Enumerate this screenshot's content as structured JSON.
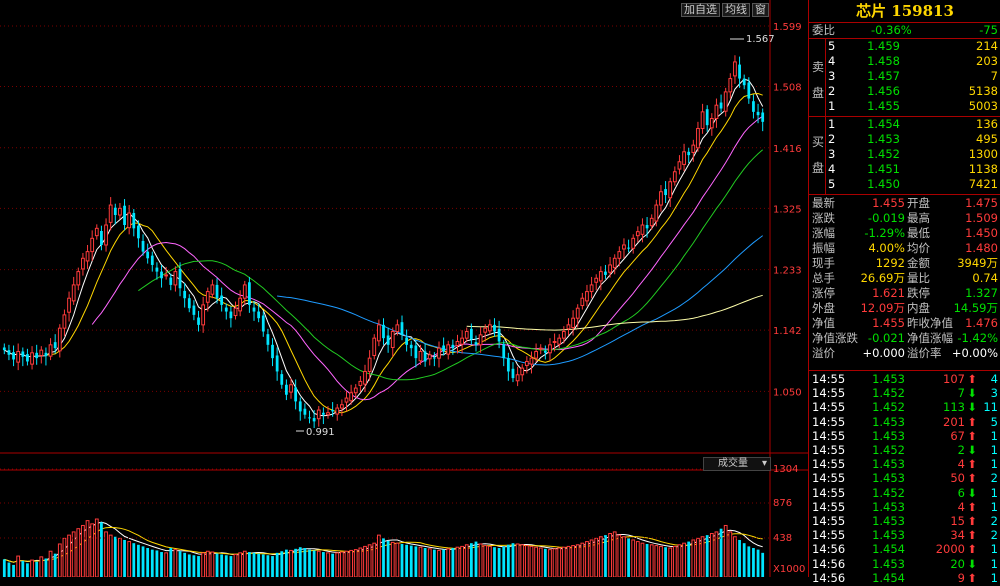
{
  "toolbar": {
    "btn1": "加自选",
    "btn2": "均线",
    "btn3": "窗"
  },
  "price_axis": {
    "labels": [
      "1.599",
      "1.508",
      "1.416",
      "1.325",
      "1.233",
      "1.142",
      "1.050"
    ],
    "min": 0.965,
    "max": 1.62
  },
  "annotations": {
    "high": "1.567",
    "low": "0.991"
  },
  "volume_axis": {
    "labels": [
      "1304",
      "876",
      "438",
      "X1000"
    ],
    "menu": "成交量"
  },
  "colors": {
    "up": "#ff3b3b",
    "down": "#00e5ff",
    "ma5": "#ffffff",
    "ma10": "#ffd700",
    "ma20": "#ff66ff",
    "ma30": "#22cc22",
    "ma60": "#1e9bff",
    "ma120": "#ffffaa"
  },
  "chart_data": {
    "type": "candlestick",
    "closes": [
      1.112,
      1.105,
      1.098,
      1.11,
      1.102,
      1.095,
      1.108,
      1.1,
      1.112,
      1.103,
      1.12,
      1.115,
      1.145,
      1.165,
      1.19,
      1.21,
      1.23,
      1.25,
      1.26,
      1.28,
      1.295,
      1.27,
      1.3,
      1.33,
      1.315,
      1.325,
      1.3,
      1.318,
      1.295,
      1.28,
      1.26,
      1.25,
      1.24,
      1.23,
      1.22,
      1.225,
      1.21,
      1.23,
      1.205,
      1.19,
      1.175,
      1.165,
      1.15,
      1.18,
      1.2,
      1.21,
      1.19,
      1.18,
      1.17,
      1.16,
      1.175,
      1.19,
      1.21,
      1.18,
      1.17,
      1.16,
      1.14,
      1.12,
      1.1,
      1.08,
      1.06,
      1.045,
      1.06,
      1.035,
      1.02,
      1.015,
      1.01,
      1.005,
      1.022,
      1.015,
      1.018,
      1.02,
      1.025,
      1.03,
      1.04,
      1.048,
      1.055,
      1.065,
      1.08,
      1.1,
      1.13,
      1.15,
      1.13,
      1.12,
      1.14,
      1.15,
      1.135,
      1.12,
      1.115,
      1.1,
      1.11,
      1.095,
      1.105,
      1.1,
      1.115,
      1.11,
      1.12,
      1.115,
      1.125,
      1.13,
      1.14,
      1.128,
      1.12,
      1.135,
      1.145,
      1.15,
      1.14,
      1.125,
      1.1,
      1.08,
      1.07,
      1.075,
      1.085,
      1.095,
      1.1,
      1.11,
      1.115,
      1.108,
      1.12,
      1.125,
      1.13,
      1.14,
      1.15,
      1.16,
      1.175,
      1.19,
      1.2,
      1.21,
      1.22,
      1.23,
      1.225,
      1.24,
      1.25,
      1.26,
      1.27,
      1.265,
      1.28,
      1.29,
      1.3,
      1.295,
      1.31,
      1.33,
      1.35,
      1.345,
      1.365,
      1.38,
      1.395,
      1.41,
      1.405,
      1.42,
      1.445,
      1.47,
      1.45,
      1.46,
      1.48,
      1.475,
      1.5,
      1.52,
      1.545,
      1.52,
      1.51,
      1.49,
      1.47,
      1.465,
      1.455
    ],
    "ma_periods": [
      5,
      10,
      20,
      30,
      60,
      120
    ],
    "volume": [
      220,
      180,
      150,
      260,
      200,
      170,
      210,
      190,
      250,
      230,
      320,
      290,
      410,
      480,
      520,
      560,
      600,
      640,
      700,
      660,
      720,
      680,
      560,
      520,
      500,
      480,
      460,
      440,
      420,
      400,
      380,
      360,
      340,
      330,
      310,
      300,
      360,
      340,
      320,
      300,
      280,
      270,
      260,
      300,
      320,
      310,
      290,
      280,
      270,
      260,
      280,
      300,
      320,
      310,
      300,
      290,
      280,
      270,
      260,
      300,
      320,
      340,
      330,
      350,
      370,
      360,
      340,
      330,
      320,
      310,
      300,
      290,
      300,
      310,
      320,
      330,
      340,
      360,
      380,
      400,
      420,
      520,
      480,
      450,
      430,
      420,
      410,
      400,
      390,
      380,
      370,
      360,
      350,
      340,
      330,
      340,
      350,
      360,
      370,
      380,
      400,
      420,
      440,
      410,
      390,
      380,
      370,
      360,
      380,
      400,
      420,
      410,
      400,
      390,
      380,
      370,
      360,
      350,
      340,
      350,
      360,
      370,
      380,
      390,
      400,
      420,
      440,
      460,
      480,
      500,
      520,
      540,
      560,
      520,
      500,
      480,
      460,
      440,
      420,
      410,
      400,
      390,
      380,
      370,
      360,
      380,
      400,
      420,
      440,
      460,
      480,
      500,
      520,
      540,
      560,
      600,
      640,
      560,
      500,
      460,
      420,
      380,
      360,
      340
    ]
  },
  "side": {
    "title": "芯片 159813",
    "weibi": {
      "label": "委比",
      "pct": "-0.36%",
      "val": "-75"
    },
    "sell_label": [
      "卖",
      "盘"
    ],
    "buy_label": [
      "买",
      "盘"
    ],
    "sell": [
      {
        "n": "5",
        "p": "1.459",
        "v": "214"
      },
      {
        "n": "4",
        "p": "1.458",
        "v": "203"
      },
      {
        "n": "3",
        "p": "1.457",
        "v": "7"
      },
      {
        "n": "2",
        "p": "1.456",
        "v": "5138"
      },
      {
        "n": "1",
        "p": "1.455",
        "v": "5003"
      }
    ],
    "buy": [
      {
        "n": "1",
        "p": "1.454",
        "v": "136"
      },
      {
        "n": "2",
        "p": "1.453",
        "v": "495"
      },
      {
        "n": "3",
        "p": "1.452",
        "v": "1300"
      },
      {
        "n": "4",
        "p": "1.451",
        "v": "1138"
      },
      {
        "n": "5",
        "p": "1.450",
        "v": "7421"
      }
    ],
    "stats": [
      {
        "l1": "最新",
        "v1": "1.455",
        "c1": "red",
        "l2": "开盘",
        "v2": "1.475",
        "c2": "red"
      },
      {
        "l1": "涨跌",
        "v1": "-0.019",
        "c1": "green",
        "l2": "最高",
        "v2": "1.509",
        "c2": "red"
      },
      {
        "l1": "涨幅",
        "v1": "-1.29%",
        "c1": "green",
        "l2": "最低",
        "v2": "1.450",
        "c2": "red"
      },
      {
        "l1": "振幅",
        "v1": "4.00%",
        "c1": "yellow",
        "l2": "均价",
        "v2": "1.480",
        "c2": "red"
      },
      {
        "l1": "现手",
        "v1": "1292",
        "c1": "yellow",
        "l2": "金额",
        "v2": "3949万",
        "c2": "yellow"
      },
      {
        "l1": "总手",
        "v1": "26.69万",
        "c1": "yellow",
        "l2": "量比",
        "v2": "0.74",
        "c2": "yellow"
      },
      {
        "l1": "涨停",
        "v1": "1.621",
        "c1": "red",
        "l2": "跌停",
        "v2": "1.327",
        "c2": "green"
      },
      {
        "l1": "外盘",
        "v1": "12.09万",
        "c1": "red",
        "l2": "内盘",
        "v2": "14.59万",
        "c2": "green"
      },
      {
        "l1": "净值",
        "v1": "1.455",
        "c1": "red",
        "l2": "昨收净值",
        "v2": "1.476",
        "c2": "red"
      },
      {
        "l1": "净值涨跌",
        "v1": "-0.021",
        "c1": "green",
        "l2": "净值涨幅",
        "v2": "-1.42%",
        "c2": "green"
      },
      {
        "l1": "溢价",
        "v1": "+0.000",
        "c1": "white",
        "l2": "溢价率",
        "v2": "+0.00%",
        "c2": "white"
      }
    ],
    "ticks": [
      {
        "t": "14:55",
        "p": "1.453",
        "v": "107",
        "d": "up",
        "n": "4"
      },
      {
        "t": "14:55",
        "p": "1.452",
        "v": "7",
        "d": "down",
        "n": "3"
      },
      {
        "t": "14:55",
        "p": "1.452",
        "v": "113",
        "d": "down",
        "n": "11"
      },
      {
        "t": "14:55",
        "p": "1.453",
        "v": "201",
        "d": "up",
        "n": "5"
      },
      {
        "t": "14:55",
        "p": "1.453",
        "v": "67",
        "d": "up",
        "n": "1"
      },
      {
        "t": "14:55",
        "p": "1.452",
        "v": "2",
        "d": "down",
        "n": "1"
      },
      {
        "t": "14:55",
        "p": "1.453",
        "v": "4",
        "d": "up",
        "n": "1"
      },
      {
        "t": "14:55",
        "p": "1.453",
        "v": "50",
        "d": "up",
        "n": "2"
      },
      {
        "t": "14:55",
        "p": "1.452",
        "v": "6",
        "d": "down",
        "n": "1"
      },
      {
        "t": "14:55",
        "p": "1.453",
        "v": "4",
        "d": "up",
        "n": "1"
      },
      {
        "t": "14:55",
        "p": "1.453",
        "v": "15",
        "d": "up",
        "n": "2"
      },
      {
        "t": "14:55",
        "p": "1.453",
        "v": "34",
        "d": "up",
        "n": "2"
      },
      {
        "t": "14:56",
        "p": "1.454",
        "v": "2000",
        "d": "up",
        "n": "1"
      },
      {
        "t": "14:56",
        "p": "1.453",
        "v": "20",
        "d": "down",
        "n": "1"
      },
      {
        "t": "14:56",
        "p": "1.454",
        "v": "9",
        "d": "up",
        "n": "1"
      }
    ]
  }
}
